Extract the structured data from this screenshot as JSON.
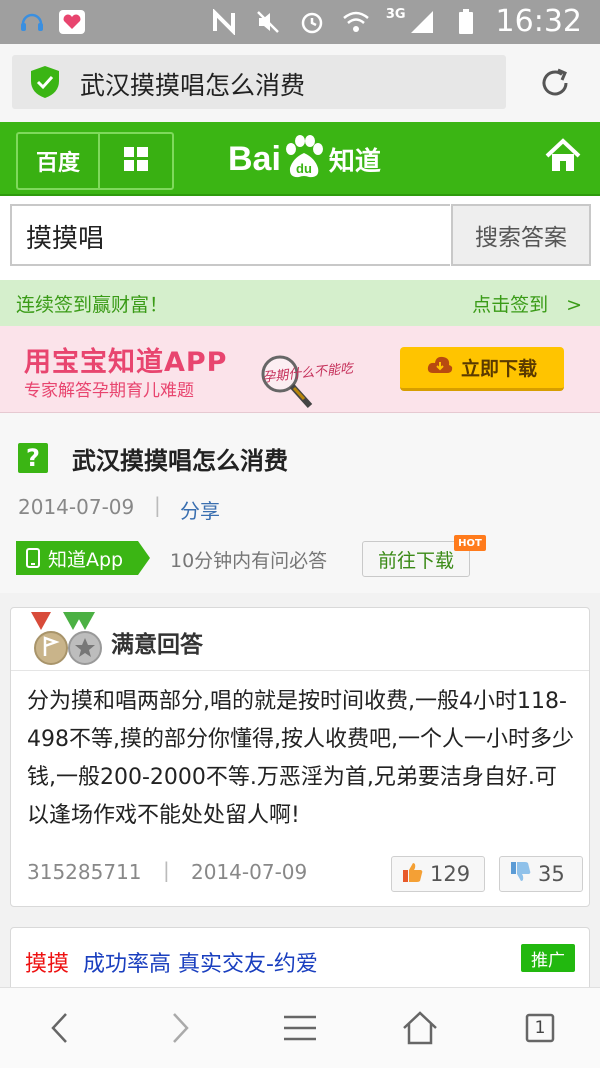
{
  "status_bar": {
    "time": "16:32",
    "network": "3G",
    "icons": [
      "headset-icon",
      "heart-app-icon",
      "nfc-icon",
      "mute-icon",
      "alarm-icon",
      "wifi-icon",
      "signal-icon",
      "battery-icon"
    ]
  },
  "url_bar": {
    "title": "武汉摸摸唱怎么消费",
    "icons": [
      "shield-check-icon",
      "reload-icon"
    ]
  },
  "nav": {
    "baidu_label": "百度",
    "logo_bai": "Bai",
    "logo_du": "du",
    "logo_zhidao": "知道",
    "icons": [
      "grid-icon",
      "paw-icon",
      "home-icon"
    ]
  },
  "search": {
    "query": "摸摸唱",
    "button_label": "搜索答案"
  },
  "sign_bar": {
    "left_text": "连续签到赢财富！",
    "right_text": "点击签到",
    "arrow": ">"
  },
  "banner": {
    "headline": "用宝宝知道APP",
    "subline": "专家解答孕期育儿难题",
    "handwriting": "孕期什么不能吃",
    "download_label": "立即下载",
    "icons": [
      "magnifier-icon",
      "cloud-download-icon"
    ]
  },
  "question": {
    "title": "武汉摸摸唱怎么消费",
    "date": "2014-07-09",
    "separator": "|",
    "share_label": "分享",
    "app_badge_label": "知道App",
    "note": "10分钟内有问必答",
    "go_download_label": "前往下载",
    "hot_label": "HOT"
  },
  "answer": {
    "header": "满意回答",
    "body": "分为摸和唱两部分,唱的就是按时间收费,一般4小时118-498不等,摸的部分你懂得,按人收费吧,一个人一小时多少钱,一般200-2000不等.万恶淫为首,兄弟要洁身自好.可以逢场作戏不能处处留人啊!",
    "user": "315285711",
    "separator": "|",
    "date": "2014-07-09",
    "upvotes": "129",
    "downvotes": "35"
  },
  "ad": {
    "keyword": "摸摸",
    "text": "成功率高 真实交友-约爱",
    "tag": "推广"
  },
  "bottom_nav": {
    "tab_count": "1",
    "icons": [
      "back-icon",
      "forward-icon",
      "menu-icon",
      "home-outline-icon",
      "tabs-icon"
    ]
  },
  "colors": {
    "brand_green": "#3bb514",
    "status_bar": "#9f9f9f",
    "sign_bar_bg": "#d5efcc",
    "banner_bg": "#fbe3ea",
    "download_yellow": "#ffc400",
    "ad_red": "#e11111",
    "ad_blue": "#1a3fbf"
  }
}
